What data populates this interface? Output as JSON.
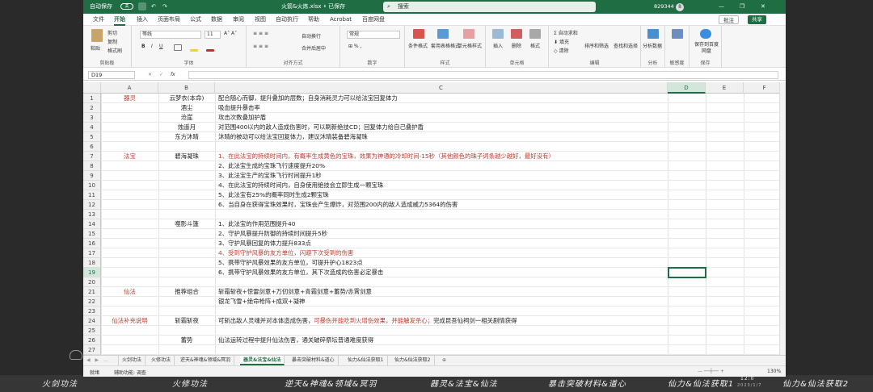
{
  "titlebar": {
    "autosave": "自动保存",
    "autosave_state": "关",
    "filename": "火箭&火炼.xlsx • 已保存",
    "search_placeholder": "搜索",
    "user": "829344",
    "avatar_letter": "8"
  },
  "menu": {
    "items": [
      "文件",
      "开始",
      "插入",
      "页面布局",
      "公式",
      "数据",
      "审阅",
      "视图",
      "自动执行",
      "帮助",
      "Acrobat",
      "百度网盘"
    ],
    "comment_btn": "批注",
    "share_btn": "共享"
  },
  "ribbon": {
    "clipboard": {
      "paste": "粘贴",
      "cut": "剪切",
      "copy": "复制",
      "format_painter": "格式刷",
      "label": "剪贴板"
    },
    "font": {
      "name": "等线",
      "size": "11",
      "label": "字体"
    },
    "alignment": {
      "wrap": "自动换行",
      "merge": "合并后居中",
      "label": "对齐方式"
    },
    "number": {
      "format": "常规",
      "label": "数字"
    },
    "styles": {
      "conditional": "条件格式",
      "table": "套用表格格式",
      "cell": "单元格样式",
      "label": "样式"
    },
    "cells": {
      "insert": "插入",
      "delete": "删除",
      "format": "格式",
      "label": "单元格"
    },
    "editing": {
      "autosum": "自动求和",
      "fill": "填充",
      "clear": "清除",
      "sort": "排序和筛选",
      "find": "查找和选择",
      "label": "编辑"
    },
    "analysis": {
      "analyze": "分析数据",
      "label": "分析"
    },
    "sensitivity": {
      "label": "敏感度"
    },
    "save": {
      "save_to": "保存到百度网盘",
      "label": "保存"
    }
  },
  "formula_bar": {
    "name_box": "D19",
    "cancel": "✕",
    "enter": "✓",
    "fx": "fx"
  },
  "sheet": {
    "columns": [
      "A",
      "B",
      "C",
      "D",
      "E",
      "F"
    ],
    "active_cell": "D19",
    "rows": [
      {
        "n": 1,
        "a": "器灵",
        "b": "云梦衣(本命)",
        "c": "配合随心而御，提升叠加的层数；自身消耗灵力可以给法宝回复体力"
      },
      {
        "n": 2,
        "a": "",
        "b": "酒尘",
        "c": "吸血提升暴击率"
      },
      {
        "n": 3,
        "a": "",
        "b": "沧崖",
        "c": "攻击次数叠加护盾"
      },
      {
        "n": 4,
        "a": "",
        "b": "烛遥月",
        "c": "对范围400以内的敌人造成伤害时，可以刷新绝技CD；回复体力给自己叠护盾"
      },
      {
        "n": 5,
        "a": "",
        "b": "东方沐晴",
        "c": "沐晴的被动可以给法宝回复体力，建议沐晴装备碧海凝珠"
      },
      {
        "n": 6,
        "a": "",
        "b": "",
        "c": ""
      },
      {
        "n": 7,
        "a": "法宝",
        "b": "碧海凝珠",
        "c": "1、在此法宝的持续时间内，有概率生成黄色的宝珠，效果为神通的冷却时间-15秒（其他颜色的珠子词条越少越好，最好没有）"
      },
      {
        "n": 8,
        "a": "",
        "b": "",
        "c": "2、此法宝生成的宝珠飞行速度提升20%"
      },
      {
        "n": 9,
        "a": "",
        "b": "",
        "c": "3、此法宝生产的宝珠飞行时间提升1秒"
      },
      {
        "n": 10,
        "a": "",
        "b": "",
        "c": "4、在此法宝的持续时间内，自身使用绝技会立即生成一颗宝珠"
      },
      {
        "n": 11,
        "a": "",
        "b": "",
        "c": "5、此法宝有25%的概率同时生成2颗宝珠"
      },
      {
        "n": 12,
        "a": "",
        "b": "",
        "c": "6、当自身在获得宝珠效果时，宝珠会产生爆炸，对范围200内的敌人造成威力5364的伤害"
      },
      {
        "n": 13,
        "a": "",
        "b": "",
        "c": ""
      },
      {
        "n": 14,
        "a": "",
        "b": "噬影斗篷",
        "c": "1、此法宝的作用范围提升40"
      },
      {
        "n": 15,
        "a": "",
        "b": "",
        "c": "2、守护风暴提升防御的持续时间提升5秒"
      },
      {
        "n": 16,
        "a": "",
        "b": "",
        "c": "3、守护风暴回复的体力提升833点"
      },
      {
        "n": 17,
        "a": "",
        "b": "",
        "c": "4、受到守护风暴的友方单位，闪避下次受到的伤害"
      },
      {
        "n": 18,
        "a": "",
        "b": "",
        "c": "5、携带守护风暴效果的友方单位，可提升护心1823点"
      },
      {
        "n": 19,
        "a": "",
        "b": "",
        "c": "6、携带守护风暴效果的友方单位，其下次造成的伤害必定暴击"
      },
      {
        "n": 20,
        "a": "",
        "b": "",
        "c": ""
      },
      {
        "n": 21,
        "a": "仙法",
        "b": "推荐组合",
        "c": " 斩霜斩夜+惊雷剑意+万仞剑意+青霜剑意+蓄势/赤霄剑意"
      },
      {
        "n": 22,
        "a": "",
        "b": "",
        "c": " 银龙飞雪+绝命枪阵+成双+凝神"
      },
      {
        "n": 23,
        "a": "",
        "b": "",
        "c": ""
      },
      {
        "n": 24,
        "a": "仙法补充说明",
        "b": "斩霜斩夜",
        "c": "可斩出敌人灵魂并对本体造成伤害，",
        "c2": "可暴伤并能吃到火增伤效果，并能触发杀心；",
        "c3": "完成昆吾仙祠剑一相关剧情获得"
      },
      {
        "n": 25,
        "a": "",
        "b": "",
        "c": ""
      },
      {
        "n": 26,
        "a": "",
        "b": "蓄势",
        "c": "仙法运转过程中提升仙法伤害，通关破碎祭坛普通难度获得"
      },
      {
        "n": 27,
        "a": "",
        "b": "",
        "c": ""
      }
    ]
  },
  "tabs": [
    "火剑功法",
    "火修功法",
    "逆天&神魂&领域&冥羽",
    "器灵&法宝&仙法",
    "暴击突破材料&道心",
    "仙力&仙法获取1",
    "仙力&仙法获取2"
  ],
  "active_tab": "器灵&法宝&仙法",
  "status": {
    "ready": "就绪",
    "accessibility": "辅助功能: 调查",
    "zoom": "130%"
  },
  "overlay": {
    "items": [
      "火剑功法",
      "火修功法",
      "逆天&神魂&领域&冥羽",
      "器灵&法宝&仙法",
      "暴击突破材料&道心",
      "仙力&仙法获取1",
      "仙力&仙法获取2"
    ],
    "clock_time": "12:0",
    "clock_date": "2023/1/7"
  },
  "colors": {
    "accent": "#1f6e43",
    "red_text": "#c0392b"
  }
}
